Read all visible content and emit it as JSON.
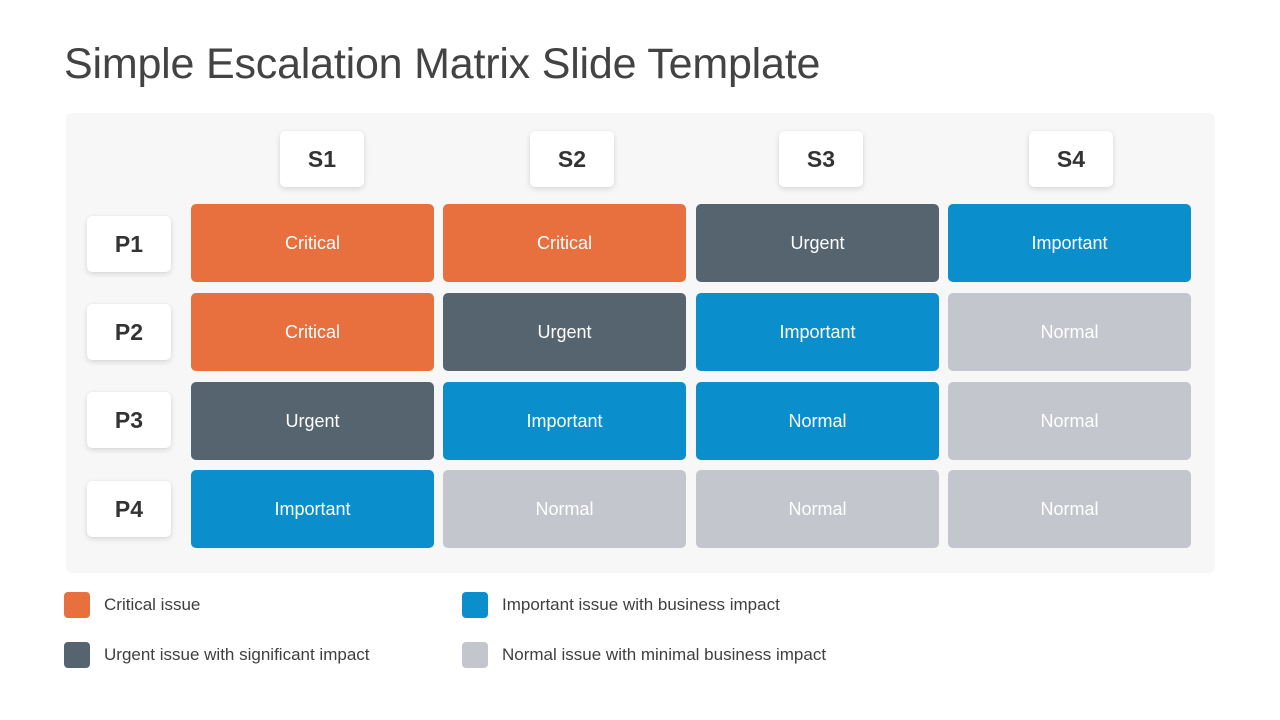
{
  "title": "Simple Escalation Matrix Slide Template",
  "colors": {
    "critical": "#E8703F",
    "urgent": "#56646F",
    "important": "#0B8ECC",
    "normal": "#C3C7CD",
    "panel_background": "#F7F7F7",
    "page_background": "#FFFFFF",
    "title_text": "#434343",
    "label_text": "#333333",
    "legend_text": "#3F3F3F"
  },
  "matrix": {
    "columns": [
      {
        "label": "S1"
      },
      {
        "label": "S2"
      },
      {
        "label": "S3"
      },
      {
        "label": "S4"
      }
    ],
    "rows": [
      {
        "label": "P1"
      },
      {
        "label": "P2"
      },
      {
        "label": "P3"
      },
      {
        "label": "P4"
      }
    ],
    "cells": [
      [
        {
          "label": "Critical",
          "level": "critical"
        },
        {
          "label": "Critical",
          "level": "critical"
        },
        {
          "label": "Urgent",
          "level": "urgent"
        },
        {
          "label": "Important",
          "level": "important"
        }
      ],
      [
        {
          "label": "Critical",
          "level": "critical"
        },
        {
          "label": "Urgent",
          "level": "urgent"
        },
        {
          "label": "Important",
          "level": "important"
        },
        {
          "label": "Normal",
          "level": "normal"
        }
      ],
      [
        {
          "label": "Urgent",
          "level": "urgent"
        },
        {
          "label": "Important",
          "level": "important"
        },
        {
          "label": "Normal",
          "level": "important"
        },
        {
          "label": "Normal",
          "level": "normal"
        }
      ],
      [
        {
          "label": "Important",
          "level": "important"
        },
        {
          "label": "Normal",
          "level": "normal"
        },
        {
          "label": "Normal",
          "level": "normal"
        },
        {
          "label": "Normal",
          "level": "normal"
        }
      ]
    ]
  },
  "legend": {
    "items": [
      {
        "label": "Critical issue",
        "level": "critical"
      },
      {
        "label": "Important issue with business impact",
        "level": "important"
      },
      {
        "label": "Urgent issue with significant impact",
        "level": "urgent"
      },
      {
        "label": "Normal issue with minimal business impact",
        "level": "normal"
      }
    ]
  }
}
